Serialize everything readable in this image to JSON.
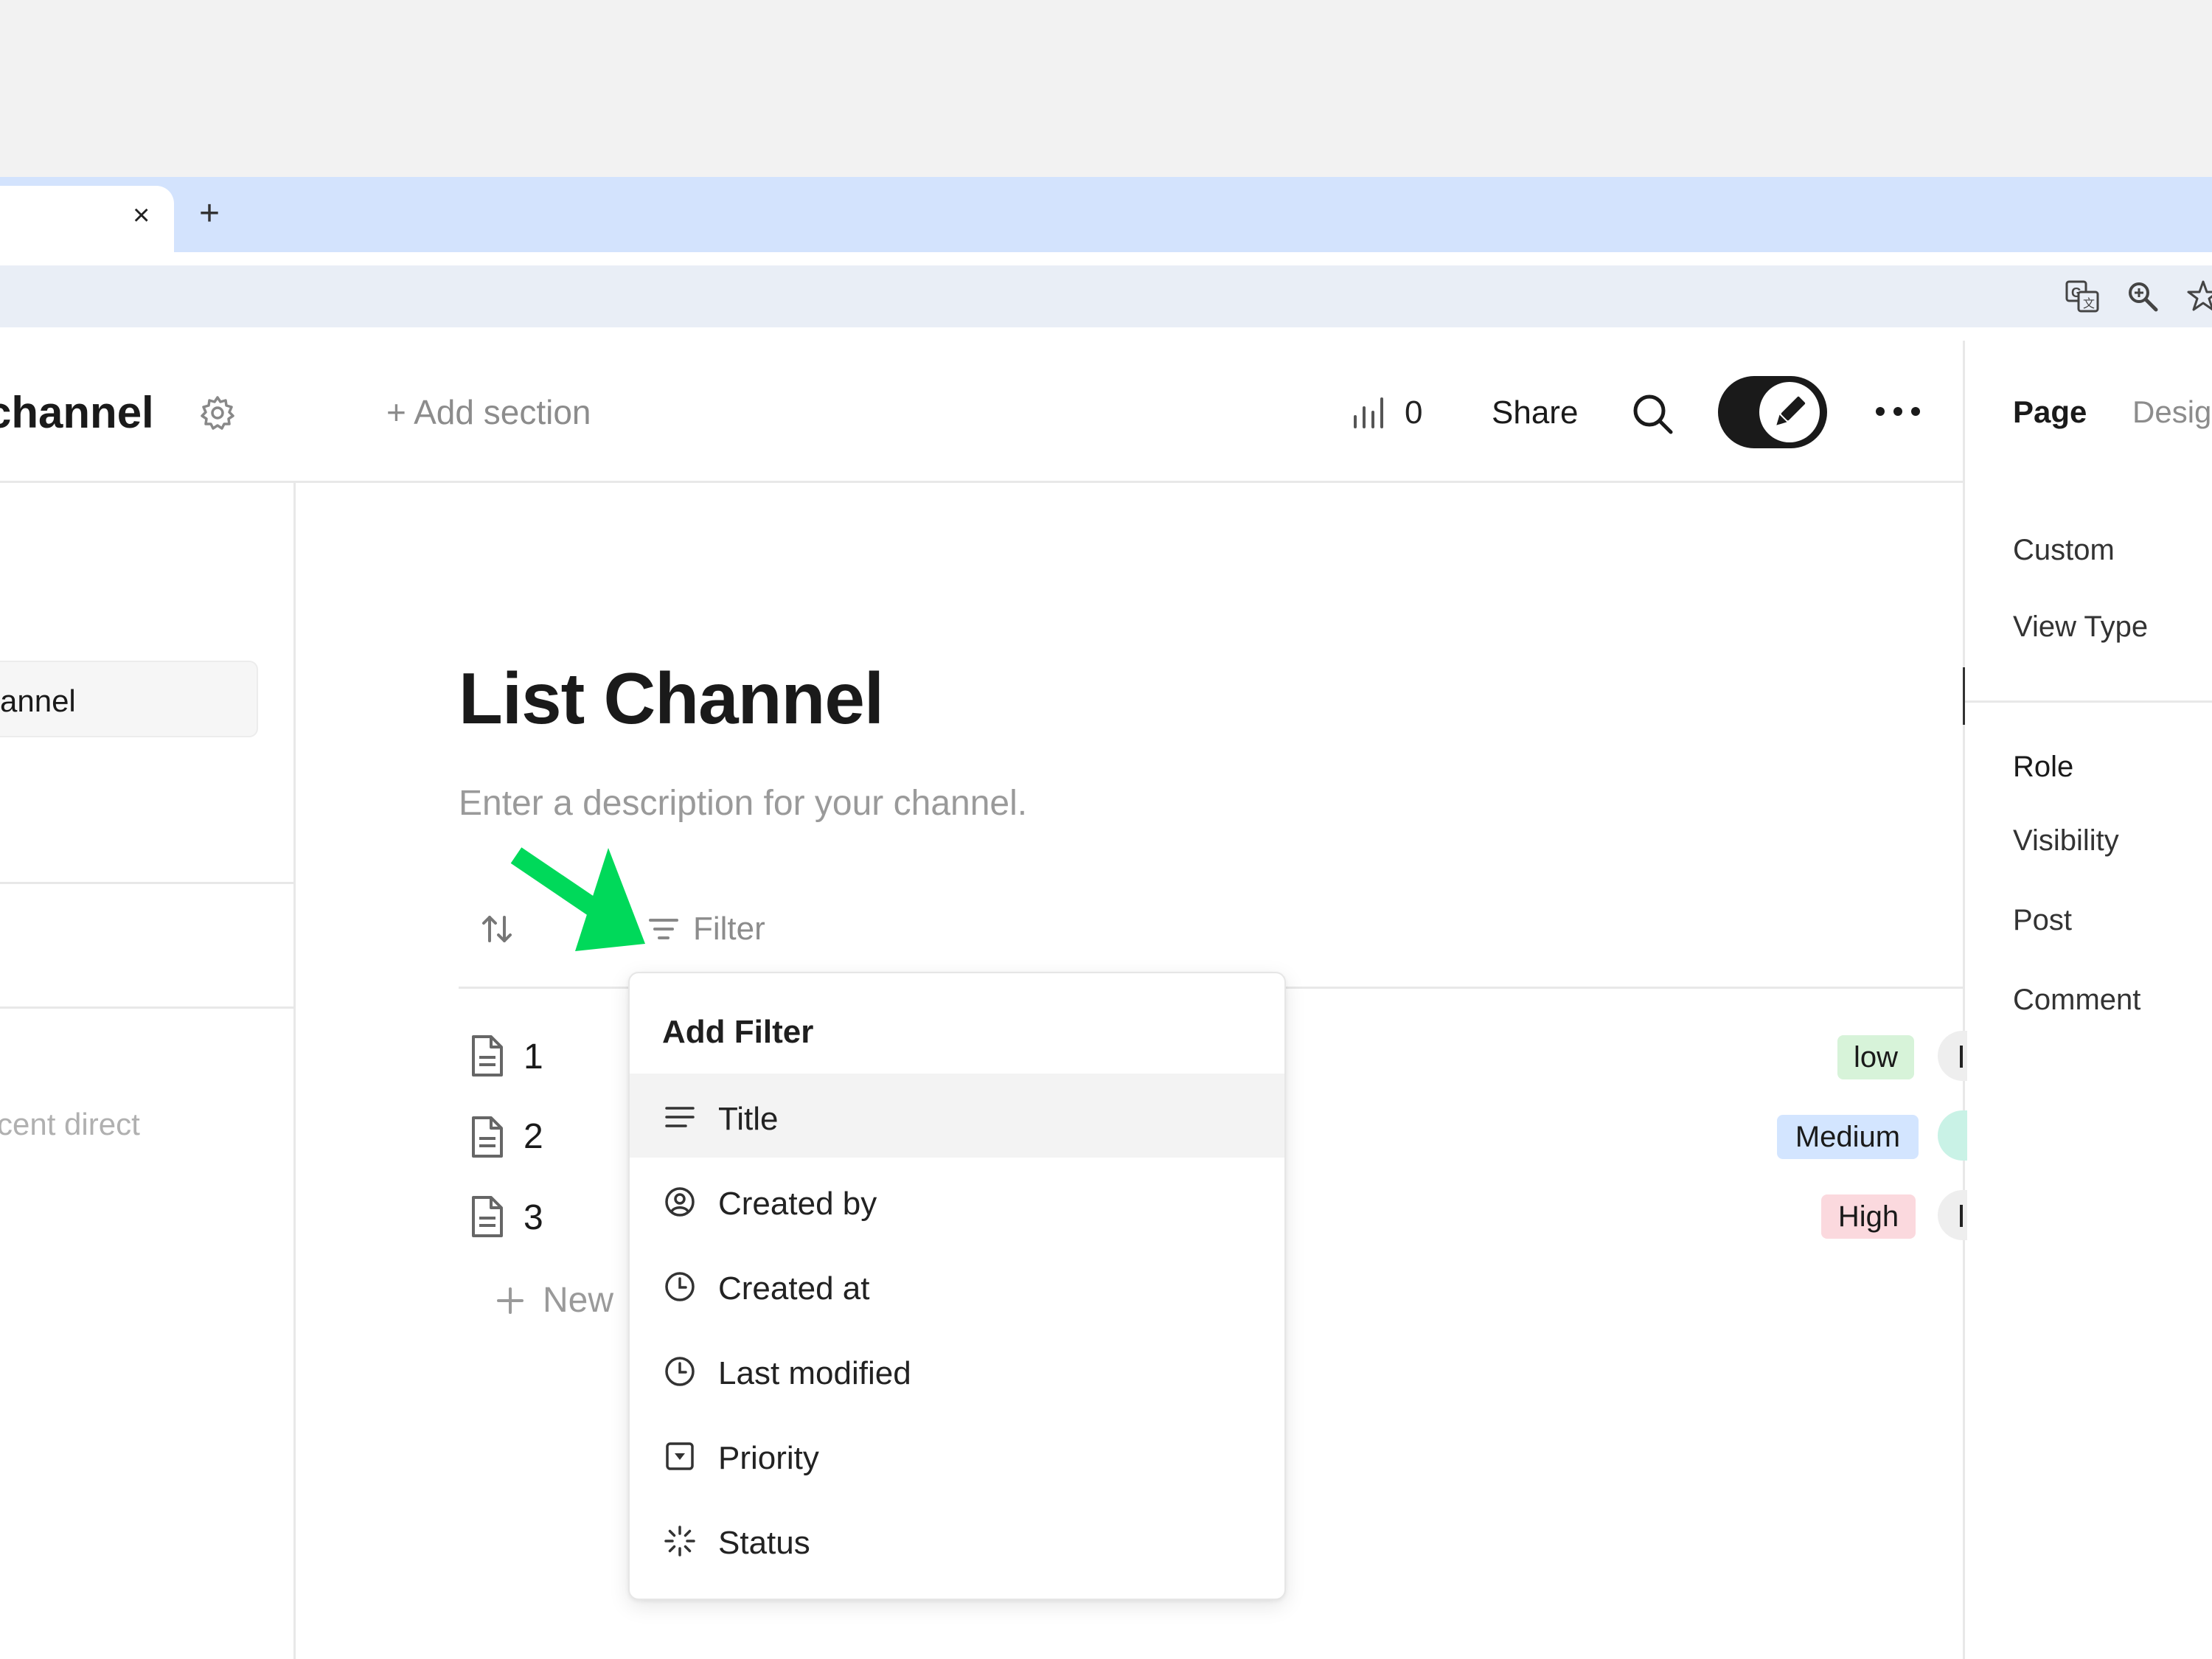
{
  "browser": {
    "close_tab_glyph": "×",
    "new_tab_glyph": "+",
    "toolbar_icons": [
      "translate-icon",
      "zoom-icon",
      "bookmark-star-icon"
    ]
  },
  "header": {
    "title": "channel",
    "add_section": "+ Add section",
    "stats_count": "0",
    "share": "Share"
  },
  "right_panel": {
    "tabs": [
      "Page",
      "Desig"
    ],
    "items_top": [
      "Custom",
      "View Type"
    ],
    "items_bottom": [
      "Role",
      "Visibility",
      "Post",
      "Comment"
    ]
  },
  "sidebar": {
    "selected_item": "annel",
    "recent_placeholder": "cent direct"
  },
  "main": {
    "title": "List Channel",
    "description_placeholder": "Enter a description for your channel.",
    "filter_label": "Filter",
    "rows": [
      {
        "title": "1",
        "priority": "low"
      },
      {
        "title": "2",
        "priority": "Medium"
      },
      {
        "title": "3",
        "priority": "High"
      }
    ],
    "new_label": "New",
    "priority_colors": {
      "low": "#d7f3d9",
      "Medium": "#d3e5ff",
      "High": "#fbd9de"
    }
  },
  "filter_menu": {
    "heading": "Add Filter",
    "items": [
      {
        "label": "Title",
        "icon": "text-lines-icon"
      },
      {
        "label": "Created by",
        "icon": "user-circle-icon"
      },
      {
        "label": "Created at",
        "icon": "clock-icon"
      },
      {
        "label": "Last modified",
        "icon": "clock-icon"
      },
      {
        "label": "Priority",
        "icon": "select-dropdown-icon"
      },
      {
        "label": "Status",
        "icon": "status-spinner-icon"
      }
    ]
  },
  "annotation": {
    "arrow_color": "#00d95a"
  }
}
